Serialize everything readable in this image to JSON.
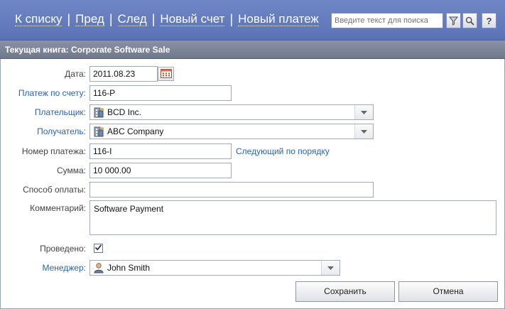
{
  "nav": {
    "items": [
      {
        "label": "К списку"
      },
      {
        "label": "Пред"
      },
      {
        "label": "След"
      },
      {
        "label": "Новый счет"
      },
      {
        "label": "Новый платеж"
      }
    ],
    "separator": "|"
  },
  "search": {
    "placeholder": "Введите текст для поиска",
    "help_label": "?"
  },
  "book": {
    "title": "Текущая книга: Corporate Software Sale"
  },
  "form": {
    "date": {
      "label": "Дата:",
      "value": "2011.08.23"
    },
    "invoice": {
      "label": "Платеж по счету:",
      "value": "116-P"
    },
    "payer": {
      "label": "Плательщик:",
      "value": "BCD Inc.",
      "icon": "company-icon"
    },
    "payee": {
      "label": "Получатель:",
      "value": "ABC Company",
      "icon": "company-icon"
    },
    "payment_number": {
      "label": "Номер платежа:",
      "value": "116-I",
      "next_link": "Следующий по порядку"
    },
    "amount": {
      "label": "Сумма:",
      "value": "10 000.00"
    },
    "method": {
      "label": "Способ оплаты:",
      "value": ""
    },
    "comment": {
      "label": "Комментарий:",
      "value": "Software Payment"
    },
    "posted": {
      "label": "Проведено:",
      "checked": true
    },
    "manager": {
      "label": "Менеджер:",
      "value": "John Smith",
      "icon": "user-icon"
    }
  },
  "buttons": {
    "save": "Сохранить",
    "cancel": "Отмена"
  },
  "colors": {
    "header": "#5b73b6",
    "book_bar": "#7a8397",
    "link": "#2a64b4"
  }
}
